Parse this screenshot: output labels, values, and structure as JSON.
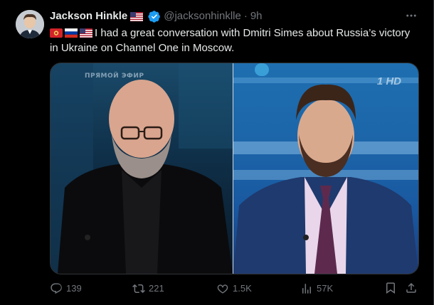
{
  "user": {
    "name": "Jackson Hinkle",
    "handle": "@jacksonhinklle",
    "separator": "·",
    "time": "9h"
  },
  "tweet": {
    "text": "I had a great conversation with Dmitri Simes about Russia’s victory in Ukraine on Channel One in Moscow."
  },
  "media": {
    "live_label": "ПРЯМОЙ ЭФИР",
    "channel_logo": "1 HD"
  },
  "actions": {
    "replies": "139",
    "reposts": "221",
    "likes": "1.5K",
    "views": "57K"
  },
  "icons": {
    "more": "more-icon",
    "verified": "verified-badge-icon",
    "reply": "reply-icon",
    "repost": "repost-icon",
    "like": "heart-icon",
    "views": "views-chart-icon",
    "bookmark": "bookmark-icon",
    "share": "share-icon"
  },
  "colors": {
    "background": "#000000",
    "text_primary": "#e7e9ea",
    "text_secondary": "#71767b",
    "verified_blue": "#1d9bf0",
    "border": "#2f3336"
  }
}
